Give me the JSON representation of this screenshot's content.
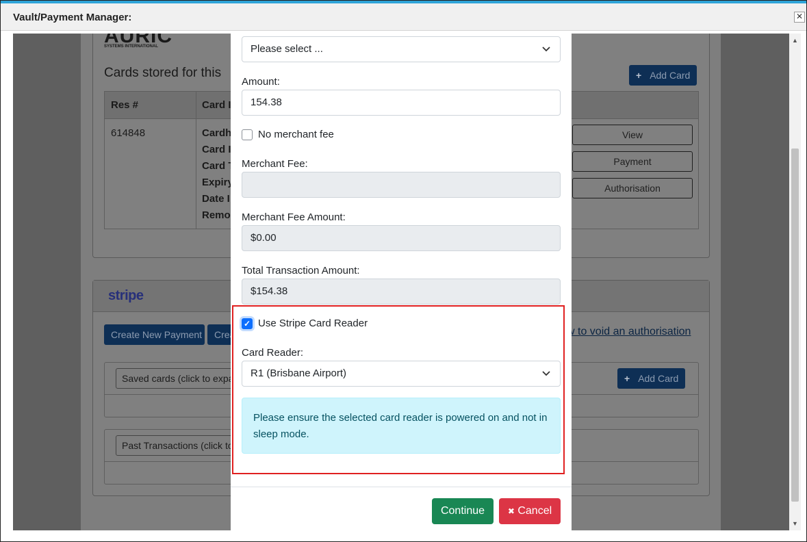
{
  "window": {
    "title": "Vault/Payment Manager:",
    "close_glyph": "✕"
  },
  "background": {
    "auric_logo_text": "AURIC",
    "auric_logo_sub": "SYSTEMS INTERNATIONAL",
    "cards_heading": "Cards stored for this",
    "add_card_label": "Add Card",
    "table_headers": [
      "Res #",
      "Card I"
    ],
    "table_res_value": "614848",
    "table_card_fields": [
      "Cardh",
      "Card I",
      "Card T",
      "Expiry",
      "Date I",
      "Remo"
    ],
    "view_label": "View",
    "payment_label": "Payment",
    "authorisation_label": "Authorisation",
    "stripe_logo_text": "stripe",
    "create_payment_label": "Create New Payment",
    "create_second_label": "Crea",
    "void_link_text": "w to void an authorisation",
    "saved_cards_placeholder": "Saved cards (click to expa",
    "past_transactions_placeholder": "Past Transactions (click to"
  },
  "modal": {
    "top_select_value": "Please select ...",
    "amount_label": "Amount:",
    "amount_value": "154.38",
    "no_merchant_fee_label": "No merchant fee",
    "merchant_fee_label": "Merchant Fee:",
    "merchant_fee_value": "",
    "merchant_fee_amount_label": "Merchant Fee Amount:",
    "merchant_fee_amount_value": "$0.00",
    "total_label": "Total Transaction Amount:",
    "total_value": "$154.38",
    "use_stripe_label": "Use Stripe Card Reader",
    "use_stripe_checked": true,
    "card_reader_label": "Card Reader:",
    "card_reader_value": "R1 (Brisbane Airport)",
    "alert_text": "Please ensure the selected card reader is powered on and not in sleep mode.",
    "continue_label": "Continue",
    "cancel_label": "Cancel",
    "cancel_icon_glyph": "✖"
  },
  "colors": {
    "highlight": "#e02020",
    "continue": "#198754",
    "cancel": "#dc3545",
    "alert_bg": "#cff4fc",
    "checkbox": "#0d6efd"
  }
}
